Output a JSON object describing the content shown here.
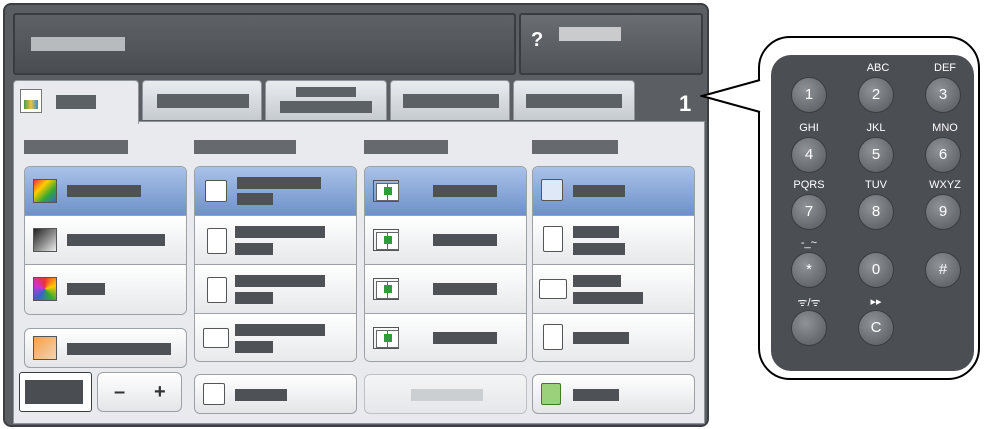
{
  "header": {
    "help_icon": "?"
  },
  "job_count": "1",
  "stepper": {
    "minus": "–",
    "plus": "+"
  },
  "keypad": {
    "keys": [
      {
        "label": "1",
        "letters": ""
      },
      {
        "label": "2",
        "letters": "ABC"
      },
      {
        "label": "3",
        "letters": "DEF"
      },
      {
        "label": "4",
        "letters": "GHI"
      },
      {
        "label": "5",
        "letters": "JKL"
      },
      {
        "label": "6",
        "letters": "MNO"
      },
      {
        "label": "7",
        "letters": "PQRS"
      },
      {
        "label": "8",
        "letters": "TUV"
      },
      {
        "label": "9",
        "letters": "WXYZ"
      },
      {
        "label": "*",
        "letters": "-_~"
      },
      {
        "label": "0",
        "letters": ""
      },
      {
        "label": "#",
        "letters": ""
      },
      {
        "label": "",
        "letters": "ᯤ/ᯤ"
      },
      {
        "label": "C",
        "letters": "▸▸"
      }
    ]
  },
  "colors": {
    "selected_row": "#7e9ed0",
    "bezel": "#5b5e62",
    "keypad": "#4b4e52"
  },
  "icons": [
    "help-icon",
    "copy-tab-icon",
    "color-auto-icon",
    "black-white-icon",
    "color-icon",
    "darken-icon",
    "paper-auto-icon",
    "tray-icon",
    "sided-icon",
    "collate-icon",
    "portrait-icon",
    "landscape-icon",
    "staple-icon",
    "finisher-icon"
  ]
}
